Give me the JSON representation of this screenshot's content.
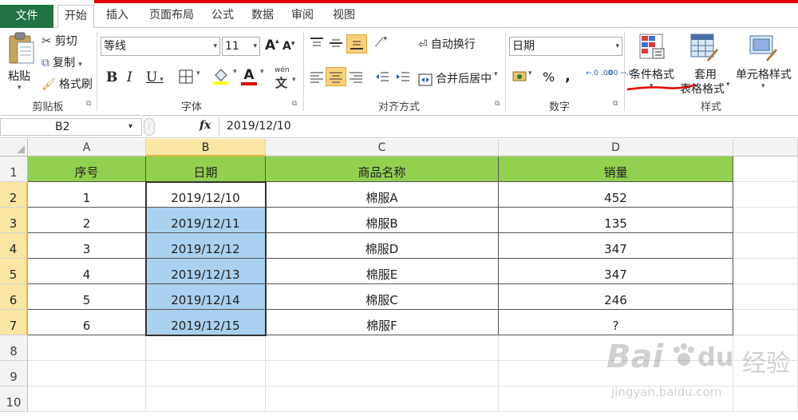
{
  "tabs": {
    "file": "文件",
    "home": "开始",
    "insert": "插入",
    "page_layout": "页面布局",
    "formulas": "公式",
    "data": "数据",
    "review": "审阅",
    "view": "视图"
  },
  "ribbon": {
    "clipboard": {
      "label": "剪贴板",
      "paste": "粘贴",
      "cut": "剪切",
      "copy": "复制",
      "format_painter": "格式刷"
    },
    "font": {
      "label": "字体",
      "name": "等线",
      "size": "11",
      "bold": "B",
      "italic": "I",
      "underline": "U",
      "grow": "A",
      "shrink": "A",
      "font_color_letter": "A",
      "wen": "wén",
      "wen_char": "文"
    },
    "alignment": {
      "label": "对齐方式",
      "wrap": "自动换行",
      "merge": "合并后居中"
    },
    "number": {
      "label": "数字",
      "format": "日期",
      "percent": "%",
      "comma": ",",
      "inc_decimal": "←.0 .00",
      "dec_decimal": ".00 →.0"
    },
    "styles": {
      "label": "样式",
      "conditional": "条件格式",
      "table_format_1": "套用",
      "table_format_2": "表格格式",
      "cell_styles": "单元格样式"
    }
  },
  "formula_bar": {
    "name_box": "B2",
    "fx": "fx",
    "value": "2019/12/10"
  },
  "grid": {
    "columns": [
      "A",
      "B",
      "C",
      "D"
    ],
    "rows": [
      "1",
      "2",
      "3",
      "4",
      "5",
      "6",
      "7",
      "8",
      "9",
      "10"
    ],
    "header": [
      "序号",
      "日期",
      "商品名称",
      "销量"
    ],
    "data": [
      [
        "1",
        "2019/12/10",
        "棉服A",
        "452"
      ],
      [
        "2",
        "2019/12/11",
        "棉服B",
        "135"
      ],
      [
        "3",
        "2019/12/12",
        "棉服D",
        "347"
      ],
      [
        "4",
        "2019/12/13",
        "棉服E",
        "347"
      ],
      [
        "5",
        "2019/12/14",
        "棉服C",
        "246"
      ],
      [
        "6",
        "2019/12/15",
        "棉服F",
        "?"
      ]
    ]
  },
  "watermark": {
    "brand": "Bai",
    "du": "du",
    "suffix": "经验",
    "url": "jingyan.baidu.com"
  },
  "colors": {
    "excel_green": "#217346",
    "header_fill": "#92d050",
    "selection_fill": "#a9d1f0",
    "annotation_red": "#e00000"
  }
}
